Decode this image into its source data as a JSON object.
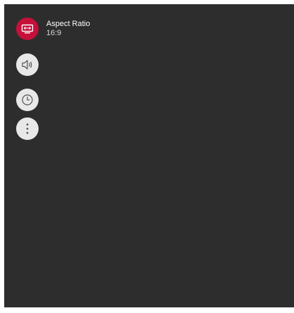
{
  "quick_menu": {
    "items": [
      {
        "icon": "aspect-ratio-icon",
        "active": true,
        "title": "Aspect Ratio",
        "value": "16:9"
      },
      {
        "icon": "sound-icon",
        "active": false
      },
      {
        "icon": "timer-icon",
        "active": false
      },
      {
        "icon": "more-options-icon",
        "active": false
      }
    ]
  },
  "colors": {
    "panel_background": "#2d2d2d",
    "active_accent": "#c5103a",
    "inactive_button": "#e8e8e8"
  }
}
